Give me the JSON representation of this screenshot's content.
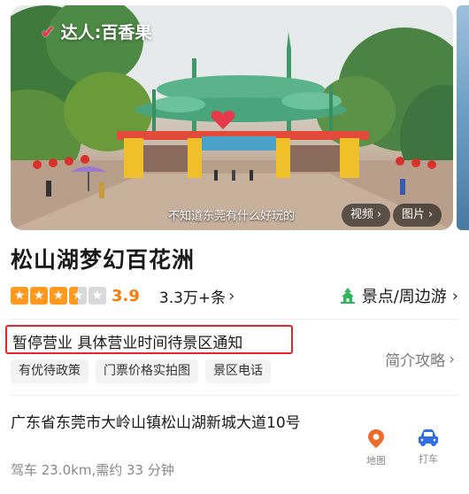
{
  "hero": {
    "creator_label": "达人:百香果",
    "caption": "不知道东莞有什么好玩的",
    "video_button": "视频",
    "photo_button": "图片",
    "chevron": "›"
  },
  "place": {
    "name": "松山湖梦幻百花洲",
    "rating_score": "3.9",
    "rating_value": 3.5,
    "rating_max": 5,
    "reviews_label": "3.3万+条",
    "category_label": "景点/周边游"
  },
  "status": {
    "text": "暂停营业 具体营业时间待景区通知",
    "intro_link": "简介攻略",
    "tags": [
      "有优待政策",
      "门票价格实拍图",
      "景区电话"
    ]
  },
  "location": {
    "address": "广东省东莞市大岭山镇松山湖新城大道10号",
    "drive_info": "驾车 23.0km,需约 33 分钟",
    "map_label": "地图",
    "taxi_label": "打车"
  },
  "colors": {
    "accent_orange": "#ff7a00",
    "star_orange": "#ff9a1f",
    "status_box_red": "#e8252a",
    "category_green": "#2fb55a",
    "map_orange": "#f06a2a",
    "taxi_blue": "#2f6fe0"
  },
  "icons": {
    "creator": "checkmark-icon",
    "category": "pagoda-icon",
    "map": "map-pin-icon",
    "taxi": "car-icon"
  }
}
